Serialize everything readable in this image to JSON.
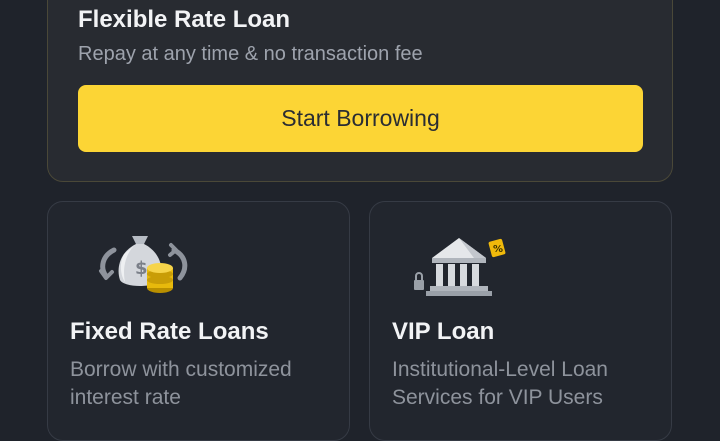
{
  "flexible": {
    "title": "Flexible Rate Loan",
    "subtitle": "Repay at any time & no transaction fee",
    "button_label": "Start Borrowing"
  },
  "cards": [
    {
      "title": "Fixed Rate Loans",
      "description": "Borrow with customized interest rate",
      "icon": "money-bag-coins-icon"
    },
    {
      "title": "VIP Loan",
      "description": "Institutional-Level Loan Services for VIP Users",
      "icon": "bank-building-icon"
    }
  ],
  "colors": {
    "background": "#1f232b",
    "accent": "#fcd535",
    "card": "#282b31",
    "text_muted": "#9ea3ad"
  }
}
